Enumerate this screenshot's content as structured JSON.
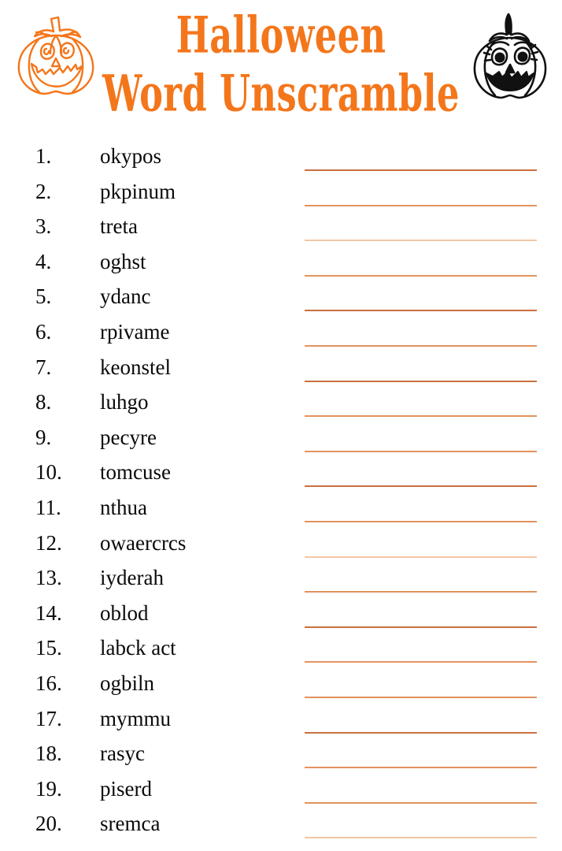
{
  "header": {
    "title_line_1": "Halloween",
    "title_line_2": "Word Unscramble",
    "accent_color": "#F4761B",
    "left_icon": "jack-o-lantern-outline-orange-icon",
    "right_icon": "jack-o-lantern-black-white-icon"
  },
  "worksheet": {
    "line_color_dark": "#C9703F",
    "line_color_mid": "#E2935F",
    "line_color_light": "#F3C7A7",
    "items": [
      {
        "number": "1.",
        "word": "okypos",
        "line_shade": "dark"
      },
      {
        "number": "2.",
        "word": "pkpinum",
        "line_shade": "mid"
      },
      {
        "number": "3.",
        "word": "treta",
        "line_shade": "light"
      },
      {
        "number": "4.",
        "word": "oghst",
        "line_shade": "mid"
      },
      {
        "number": "5.",
        "word": "ydanc",
        "line_shade": "dark"
      },
      {
        "number": "6.",
        "word": "rpivame",
        "line_shade": "mid"
      },
      {
        "number": "7.",
        "word": "keonstel",
        "line_shade": "dark"
      },
      {
        "number": "8.",
        "word": "luhgo",
        "line_shade": "mid"
      },
      {
        "number": "9.",
        "word": "pecyre",
        "line_shade": "mid"
      },
      {
        "number": "10.",
        "word": "tomcuse",
        "line_shade": "dark"
      },
      {
        "number": "11.",
        "word": "nthua",
        "line_shade": "mid"
      },
      {
        "number": "12.",
        "word": "owaercrcs",
        "line_shade": "light"
      },
      {
        "number": "13.",
        "word": "iyderah",
        "line_shade": "mid"
      },
      {
        "number": "14.",
        "word": "oblod",
        "line_shade": "dark"
      },
      {
        "number": "15.",
        "word": "labck act",
        "line_shade": "mid"
      },
      {
        "number": "16.",
        "word": "ogbiln",
        "line_shade": "mid"
      },
      {
        "number": "17.",
        "word": "mymmu",
        "line_shade": "dark"
      },
      {
        "number": "18.",
        "word": "rasyc",
        "line_shade": "mid"
      },
      {
        "number": "19.",
        "word": "piserd",
        "line_shade": "mid"
      },
      {
        "number": "20.",
        "word": "sremca",
        "line_shade": "light"
      }
    ]
  }
}
